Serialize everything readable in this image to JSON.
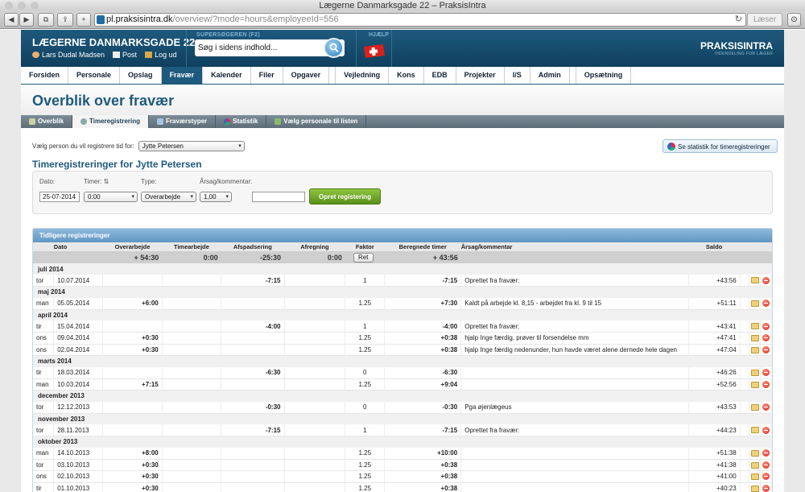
{
  "browser": {
    "title": "Lægerne Danmarksgade 22 – PraksisIntra",
    "url_host": "pl.praksisintra.dk",
    "url_path": "/overview/?mode=hours&employeeId=556",
    "reader_label": "Læser"
  },
  "header": {
    "site_title": "LÆGERNE DANMARKSGADE 22",
    "user_name": "Lars Dudal Madsen",
    "post_label": "Post",
    "logout_label": "Log ud",
    "search_label": "SUPERSØGEREN (F2)",
    "search_placeholder": "Søg i sidens indhold...",
    "help_label": "HJÆLP",
    "brand": "PRAKSISINTRA",
    "brand_tagline": "VIDENDELING FOR LÆGER"
  },
  "nav": {
    "tabs_left": [
      "Forsiden",
      "Personale",
      "Opslag",
      "Fravær",
      "Kalender",
      "Filer",
      "Opgaver"
    ],
    "tabs_right": [
      "Vejledning",
      "Kons",
      "EDB",
      "Projekter",
      "I/S",
      "Admin",
      "Opsætning"
    ],
    "active": "Fravær"
  },
  "page": {
    "title": "Overblik over fravær",
    "subtabs": [
      "Overblik",
      "Timeregistrering",
      "Fraværstyper",
      "Statistik",
      "Vælg personale til listen"
    ],
    "active_subtab": "Timeregistrering",
    "select_label": "Vælg person du vil registrere tid for:",
    "selected_person": "Jytte Petersen",
    "stat_button": "Se statistik for timeregistreringer",
    "section_title": "Timeregistreringer for Jytte Petersen"
  },
  "form": {
    "date_label": "Dato:",
    "hours_label": "Timer:",
    "hours_sort": "⇅",
    "type_label": "Type:",
    "reason_label": "Årsag/kommentar:",
    "date_value": "25-07-2014",
    "hours_value": "0:00",
    "type_value": "Overarbejde",
    "factor_value": "1,00",
    "submit_label": "Opret registering"
  },
  "table": {
    "title": "Tidligere registreringer",
    "columns": [
      "Dato",
      "Overarbejde",
      "Timearbejde",
      "Afspadsering",
      "Afregning",
      "Faktor",
      "Beregnede timer",
      "Årsag/kommentar",
      "Saldo"
    ],
    "totals": {
      "overarbejde": "+ 54:30",
      "timearbejde": "0:00",
      "afspadsering": "-25:30",
      "afregning": "0:00",
      "faktor_btn": "Ret",
      "beregnet": "+ 43:56"
    },
    "groups": [
      {
        "month": "juli 2014",
        "rows": [
          {
            "day": "tor",
            "date": "10.07.2014",
            "over": "",
            "time": "",
            "afsp": "-7:15",
            "afr": "",
            "faktor": "1",
            "beregnet": "-7:15",
            "comment": "Oprettet fra fravær:",
            "saldo": "+43:56"
          }
        ]
      },
      {
        "month": "maj 2014",
        "rows": [
          {
            "day": "man",
            "date": "05.05.2014",
            "over": "+6:00",
            "time": "",
            "afsp": "",
            "afr": "",
            "faktor": "1.25",
            "beregnet": "+7:30",
            "comment": "Kaldt på arbejde kl. 8,15 - arbejdet fra kl. 9 til 15",
            "saldo": "+51:11"
          }
        ]
      },
      {
        "month": "april 2014",
        "rows": [
          {
            "day": "tir",
            "date": "15.04.2014",
            "over": "",
            "time": "",
            "afsp": "-4:00",
            "afr": "",
            "faktor": "1",
            "beregnet": "-4:00",
            "comment": "Oprettet fra fravær:",
            "saldo": "+43:41"
          },
          {
            "day": "ons",
            "date": "09.04.2014",
            "over": "+0:30",
            "time": "",
            "afsp": "",
            "afr": "",
            "faktor": "1.25",
            "beregnet": "+0:38",
            "comment": "hjalp Inge færdig, prøver til forsendelse mm",
            "saldo": "+47:41"
          },
          {
            "day": "ons",
            "date": "02.04.2014",
            "over": "+0:30",
            "time": "",
            "afsp": "",
            "afr": "",
            "faktor": "1.25",
            "beregnet": "+0:38",
            "comment": "hjalp Inge færdig nedenunder, hun havde været alene dernede hele dagen",
            "saldo": "+47:04"
          }
        ]
      },
      {
        "month": "marts 2014",
        "rows": [
          {
            "day": "tir",
            "date": "18.03.2014",
            "over": "",
            "time": "",
            "afsp": "-6:30",
            "afr": "",
            "faktor": "0",
            "beregnet": "-6:30",
            "comment": "",
            "saldo": "+46:26"
          },
          {
            "day": "man",
            "date": "10.03.2014",
            "over": "+7:15",
            "time": "",
            "afsp": "",
            "afr": "",
            "faktor": "1.25",
            "beregnet": "+9:04",
            "comment": "",
            "saldo": "+52:56"
          }
        ]
      },
      {
        "month": "december 2013",
        "rows": [
          {
            "day": "tor",
            "date": "12.12.2013",
            "over": "",
            "time": "",
            "afsp": "-0:30",
            "afr": "",
            "faktor": "0",
            "beregnet": "-0:30",
            "comment": "Pga øjenlægeus",
            "saldo": "+43:53"
          }
        ]
      },
      {
        "month": "november 2013",
        "rows": [
          {
            "day": "tor",
            "date": "28.11.2013",
            "over": "",
            "time": "",
            "afsp": "-7:15",
            "afr": "",
            "faktor": "1",
            "beregnet": "-7:15",
            "comment": "Oprettet fra fravær:",
            "saldo": "+44:23"
          }
        ]
      },
      {
        "month": "oktober 2013",
        "rows": [
          {
            "day": "man",
            "date": "14.10.2013",
            "over": "+8:00",
            "time": "",
            "afsp": "",
            "afr": "",
            "faktor": "1.25",
            "beregnet": "+10:00",
            "comment": "",
            "saldo": "+51:38"
          },
          {
            "day": "tor",
            "date": "03.10.2013",
            "over": "+0:30",
            "time": "",
            "afsp": "",
            "afr": "",
            "faktor": "1.25",
            "beregnet": "+0:38",
            "comment": "",
            "saldo": "+41:38"
          },
          {
            "day": "ons",
            "date": "02.10.2013",
            "over": "+0:30",
            "time": "",
            "afsp": "",
            "afr": "",
            "faktor": "1.25",
            "beregnet": "+0:38",
            "comment": "",
            "saldo": "+41:00"
          },
          {
            "day": "tir",
            "date": "01.10.2013",
            "over": "+0:30",
            "time": "",
            "afsp": "",
            "afr": "",
            "faktor": "1.25",
            "beregnet": "+0:38",
            "comment": "",
            "saldo": "+40:23"
          }
        ]
      }
    ]
  },
  "colors": {
    "brand": "#1e5a7d",
    "accent_green": "#6fa52a",
    "delete_red": "#d12a1a"
  }
}
